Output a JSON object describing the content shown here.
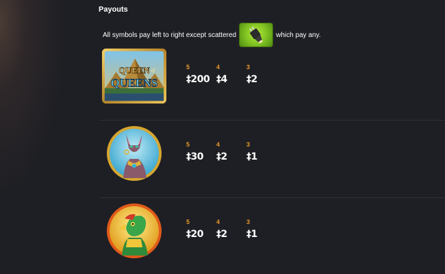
{
  "payouts": {
    "title": "Payouts",
    "intro_before": "All symbols pay left to right except scattered",
    "intro_after": "which pay any.",
    "scatter_icon": "plug-scatter-icon",
    "rows": [
      {
        "symbol": "queen-of-queens-logo",
        "logo_text_top": "QUEEN",
        "logo_text_of": "of",
        "logo_text_bottom": "QUEENS",
        "counts": [
          "5",
          "4",
          "3"
        ],
        "pays": [
          "‡200",
          "‡4",
          "‡2"
        ]
      },
      {
        "symbol": "cat-goddess-icon",
        "counts": [
          "5",
          "4",
          "3"
        ],
        "pays": [
          "‡30",
          "‡2",
          "‡1"
        ]
      },
      {
        "symbol": "falcon-god-icon",
        "counts": [
          "5",
          "4",
          "3"
        ],
        "pays": [
          "‡20",
          "‡2",
          "‡1"
        ]
      }
    ]
  }
}
